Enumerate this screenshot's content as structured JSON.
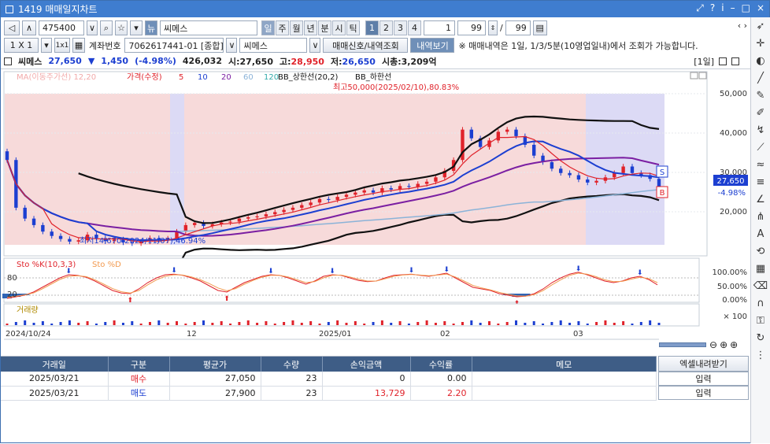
{
  "window": {
    "title": "1419 매매일지차트",
    "buttons": [
      "?",
      "?",
      "–",
      "□",
      "×"
    ]
  },
  "toolbar1": {
    "code": "475400",
    "stock_badge": "뉴",
    "stock_name": "씨메스",
    "periods": [
      "일",
      "주",
      "월",
      "년",
      "분",
      "시",
      "틱"
    ],
    "active_period": "일",
    "nums": [
      "1",
      "2",
      "3",
      "4"
    ],
    "active_num": "1",
    "count1": "1",
    "count2": "99",
    "slash": "/",
    "count3": "99"
  },
  "toolbar2": {
    "ratio1": "1 X 1",
    "ratio2": "1x1",
    "account_label": "계좌번호",
    "account_value": "7062617441-01 [종합]",
    "stock_select": "씨메스",
    "btn_signal": "매매신호/내역조회",
    "btn_history": "내역보기",
    "notice": "※ 매매내역은 1일, 1/3/5분(10영업일내)에서 조회가 가능합니다."
  },
  "infobar": {
    "name": "씨메스",
    "price": "27,650",
    "arrow": "▼",
    "change": "1,450",
    "change_pct": "(-4.98%)",
    "volume": "426,032",
    "open_label": "시:",
    "open": "27,650",
    "high_label": "고:",
    "high": "28,950",
    "low_label": "저:",
    "low": "26,650",
    "cap_label": "시총:",
    "cap": "3,209억",
    "period_tag": "[1일]"
  },
  "legend": {
    "ma_label": "MA(이동주가선) 12,20",
    "price_label": "가격(수정)",
    "ma": [
      "5",
      "10",
      "20",
      "60",
      "120"
    ],
    "bb_upper": "BB_상한선(20,2)",
    "bb_lower": "BB_하한선"
  },
  "annotations": {
    "high": "최고50,000(2025/02/10),80.83%",
    "low": "최저14,670(2024/11/07),46.94%",
    "price_tag": "27,650",
    "pct_tag": "-4.98%",
    "sell_marker": "S",
    "buy_marker": "B"
  },
  "price_axis": [
    "50,000",
    "40,000",
    "30,000",
    "20,000"
  ],
  "sto": {
    "label1": "Sto %K(10,3,3)",
    "label2": "Sto %D",
    "left_ticks": [
      "80",
      "20"
    ],
    "right_ticks": [
      "100.00%",
      "50.00%",
      "0.00%"
    ]
  },
  "volume": {
    "label": "거래량",
    "axis": "× 100"
  },
  "date_axis": [
    "2024/10/24",
    "12",
    "2025/01",
    "02",
    "03"
  ],
  "chart_data": {
    "type": "candlestick",
    "x_range": [
      "2024/10/24",
      "2025/03/21"
    ],
    "ylim": [
      13000,
      52000
    ],
    "series_points": {
      "price_close": [
        34000,
        23000,
        20500,
        19000,
        17500,
        16500,
        15800,
        15200,
        15500,
        16800,
        16000,
        15300,
        15700,
        15000,
        14800,
        15200,
        16000,
        15500,
        15900,
        17500,
        19000,
        19500,
        18800,
        19200,
        19600,
        19800,
        20500,
        20800,
        21000,
        21500,
        22000,
        22500,
        23000,
        23600,
        24200,
        25000,
        24800,
        25500,
        26000,
        26500,
        27000,
        26500,
        27500,
        27200,
        28000,
        27800,
        28500,
        29000,
        30000,
        31500,
        34000,
        41000,
        39000,
        37000,
        38500,
        40500,
        41000,
        39500,
        37500,
        35000,
        33500,
        32000,
        31000,
        30500,
        29500,
        28800,
        29200,
        30000,
        31000,
        32500,
        31000,
        30500,
        29650,
        27650
      ],
      "stoK": [
        5,
        10,
        15,
        25,
        40,
        55,
        70,
        80,
        78,
        72,
        60,
        45,
        30,
        22,
        20,
        35,
        55,
        70,
        80,
        82,
        78,
        70,
        60,
        45,
        30,
        25,
        40,
        55,
        65,
        75,
        80,
        78,
        70,
        60,
        50,
        60,
        75,
        80,
        78,
        70,
        62,
        58,
        60,
        70,
        78,
        80,
        82,
        78,
        75,
        80,
        85,
        70,
        55,
        40,
        35,
        30,
        20,
        15,
        10,
        12,
        20,
        35,
        55,
        70,
        82,
        88,
        80,
        70,
        60,
        55,
        60,
        70,
        75,
        65,
        48
      ],
      "stoD": [
        8,
        12,
        16,
        22,
        35,
        50,
        65,
        75,
        77,
        74,
        64,
        50,
        36,
        26,
        22,
        30,
        48,
        64,
        75,
        80,
        79,
        73,
        64,
        52,
        38,
        29,
        36,
        50,
        62,
        72,
        78,
        78,
        73,
        64,
        55,
        58,
        70,
        78,
        79,
        73,
        66,
        60,
        60,
        67,
        75,
        79,
        81,
        79,
        77,
        79,
        82,
        73,
        60,
        46,
        38,
        32,
        24,
        18,
        13,
        12,
        17,
        30,
        48,
        64,
        78,
        85,
        82,
        74,
        64,
        58,
        59,
        66,
        72,
        68,
        55
      ]
    }
  },
  "table": {
    "headers": [
      "거래일",
      "구분",
      "평균가",
      "수량",
      "손익금액",
      "수익률",
      "메모"
    ],
    "rows": [
      [
        "2025/03/21",
        "매수",
        "27,050",
        "23",
        "0",
        "0.00",
        ""
      ],
      [
        "2025/03/21",
        "매도",
        "27,900",
        "23",
        "13,729",
        "2.20",
        ""
      ]
    ]
  },
  "right_panel": {
    "excel_btn": "엑셀내려받기",
    "input_btn1": "입력",
    "input_btn2": "입력"
  },
  "colors": {
    "titlebar": "#3f7dcf",
    "pink_zone": "#f7dada",
    "blue_zone": "#dcdaf5",
    "up": "#e0222a",
    "down": "#1c3fd1",
    "bb": "#111111",
    "ma5": "#e0222a",
    "ma10": "#1c3fd1",
    "ma20": "#7b1fa2",
    "ma60": "#8bb3d8"
  }
}
